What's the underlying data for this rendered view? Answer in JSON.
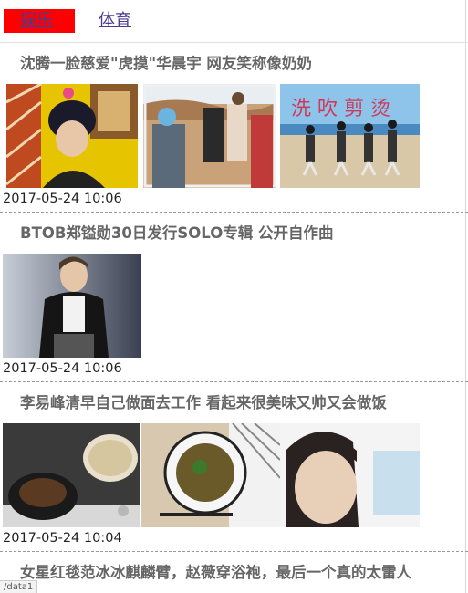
{
  "tabs": [
    {
      "label": "娱乐",
      "active": true
    },
    {
      "label": "体育",
      "active": false
    }
  ],
  "news": [
    {
      "title": "沈腾一脸慈爱\"虎摸\"华晨宇 网友笑称像奶奶",
      "time": "2017-05-24 10:06",
      "images": [
        "photo-singer-yellow-bg",
        "photo-desert-group",
        "photo-beach-dance"
      ],
      "image_text": "洗 吹 剪 烫"
    },
    {
      "title": "BTOB郑镒勋30日发行SOLO专辑 公开自作曲",
      "time": "2017-05-24 10:06",
      "images": [
        "photo-singer-stage"
      ]
    },
    {
      "title": "李易峰清早自己做面去工作 看起来很美味又帅又会做饭",
      "time": "2017-05-24 10:04",
      "images": [
        "photo-noodles-stove",
        "photo-noodle-bowl",
        "photo-selfie"
      ]
    },
    {
      "title": "女星红毯范冰冰麒麟臂，赵薇穿浴袍，最后一个真的太雷人"
    }
  ],
  "status_url": "/data1"
}
